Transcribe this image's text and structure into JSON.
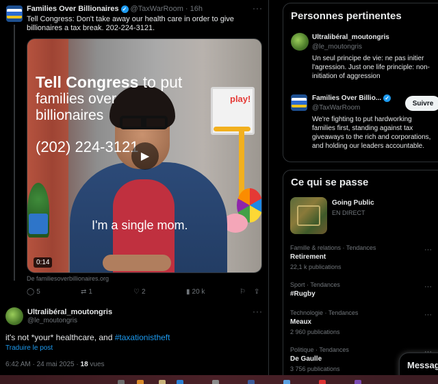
{
  "tweet": {
    "author": "Families Over Billionaires",
    "handle": "@TaxWarRoom",
    "time": "16h",
    "text": "Tell Congress: Don't take away our health care in order to give billionaires a tax break. 202-224-3121.",
    "video": {
      "headline_bold": "Tell Congress",
      "headline_rest": " to put",
      "line2": "families over",
      "line3": "billionaires",
      "phone": "(202) 224-3121",
      "caption": "I'm a single mom.",
      "play_sign": "play!",
      "duration": "0:14"
    },
    "source": "De familiesoverbillionaires.org",
    "actions": {
      "replies": "5",
      "reposts": "1",
      "likes": "2",
      "views": "20 k"
    }
  },
  "reply": {
    "author": "Ultralibéral_moutongris",
    "handle": "@le_moutongris",
    "text_plain": "it's not *your* healthcare, and ",
    "hashtag": "#taxationistheft",
    "translate": "Traduire le post",
    "timestamp": "6:42 AM · 24 mai 2025 · ",
    "views_count": "18",
    "views_label": " vues"
  },
  "relevant_people": {
    "title": "Personnes pertinentes",
    "people": [
      {
        "name": "Ultralibéral_moutongris",
        "handle": "@le_moutongris",
        "bio": "Un seul principe de vie: ne pas initier l'agression. Just one life principle: non-initiation of aggression"
      },
      {
        "name": "Families Over Billio...",
        "handle": "@TaxWarRoom",
        "bio": "We're fighting to put hardworking families first, standing against tax giveaways to the rich and corporations, and holding our leaders accountable.",
        "follow_label": "Suivre"
      }
    ]
  },
  "trends": {
    "title": "Ce qui se passe",
    "featured": {
      "name": "Going Public",
      "status": "EN DIRECT"
    },
    "items": [
      {
        "category": "Famille & relations · Tendances",
        "name": "Retirement",
        "count": "22,1 k publications"
      },
      {
        "category": "Sport · Tendances",
        "name": "#Rugby",
        "count": ""
      },
      {
        "category": "Technologie · Tendances",
        "name": "Meaux",
        "count": "2 960 publications"
      },
      {
        "category": "Politique · Tendances",
        "name": "De Gaulle",
        "count": "3 756 publications"
      }
    ]
  },
  "messages_label": "Messag",
  "colors": {
    "accent": "#1d9bf0",
    "background": "#000000",
    "text": "#e7e9ea",
    "muted": "#71767b",
    "border": "#2f3336"
  }
}
